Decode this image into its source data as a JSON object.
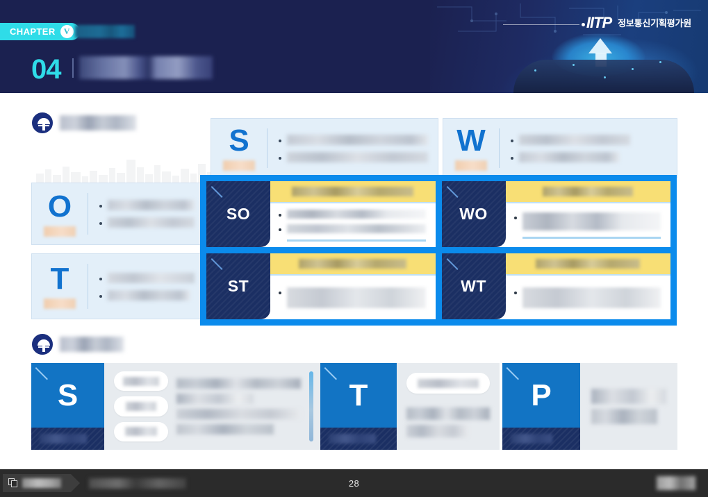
{
  "header": {
    "chapter_label": "CHAPTER",
    "chapter_numeral": "V",
    "chapter_tag_text": "",
    "section_number": "04",
    "section_title": "",
    "logo_mark": "IITP",
    "logo_text": "정보통신기획평가원",
    "background_colors": {
      "navy": "#1b2150",
      "cyan": "#2fdce8"
    }
  },
  "swot_section": {
    "heading": "",
    "icon": "tree-badge-icon",
    "cells": [
      {
        "letter": "S",
        "label": "",
        "bullets": [
          "",
          ""
        ]
      },
      {
        "letter": "W",
        "label": "",
        "bullets": [
          "",
          ""
        ]
      },
      {
        "letter": "O",
        "label": "",
        "bullets": [
          "",
          ""
        ]
      },
      {
        "letter": "T",
        "label": "",
        "bullets": [
          "",
          ""
        ]
      }
    ],
    "strategy_frame": {
      "accent_color": "#0b8bec",
      "tab_color": "#1b2f63",
      "title_bar_color": "#f8df75",
      "cards": [
        {
          "code": "SO",
          "title": "",
          "bullets": [
            "",
            ""
          ]
        },
        {
          "code": "WO",
          "title": "",
          "bullets": [
            ""
          ]
        },
        {
          "code": "ST",
          "title": "",
          "bullets": [
            ""
          ]
        },
        {
          "code": "WT",
          "title": "",
          "bullets": [
            ""
          ]
        }
      ]
    }
  },
  "stp_section": {
    "heading": "",
    "icon": "tree-badge-icon",
    "cards": [
      {
        "letter": "S",
        "footer_label": "",
        "chips": [
          "",
          "",
          ""
        ],
        "lines": [
          "",
          "",
          "",
          ""
        ]
      },
      {
        "letter": "T",
        "footer_label": "",
        "chips": [
          ""
        ],
        "lines": [
          "",
          ""
        ]
      },
      {
        "letter": "P",
        "footer_label": "",
        "chips": [],
        "lines": [
          "",
          ""
        ]
      }
    ]
  },
  "statusbar": {
    "tag_label": "",
    "tag_icon": "copy-check-icon",
    "breadcrumb": "",
    "page_number": "28",
    "right_label": ""
  }
}
